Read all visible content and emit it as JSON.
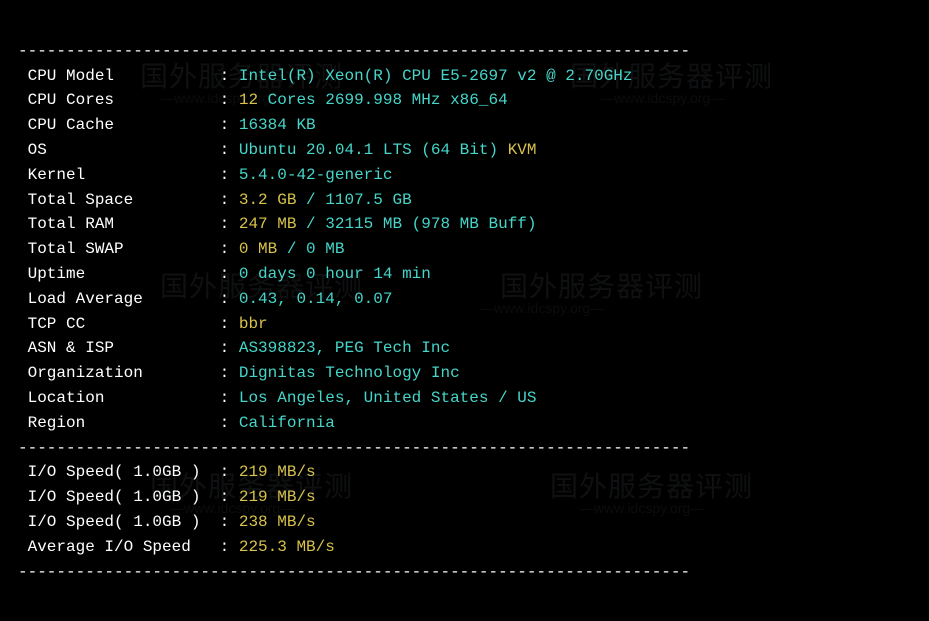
{
  "dash": "----------------------------------------------------------------------",
  "labels": {
    "cpu_model": " CPU Model          ",
    "cpu_cores": " CPU Cores          ",
    "cpu_cache": " CPU Cache          ",
    "os": " OS                 ",
    "kernel": " Kernel             ",
    "space": " Total Space        ",
    "ram": " Total RAM          ",
    "swap": " Total SWAP         ",
    "uptime": " Uptime             ",
    "load": " Load Average       ",
    "tcp": " TCP CC             ",
    "asn": " ASN & ISP          ",
    "org": " Organization       ",
    "loc": " Location           ",
    "region": " Region             ",
    "io1": " I/O Speed( 1.0GB ) ",
    "io2": " I/O Speed( 1.0GB ) ",
    "io3": " I/O Speed( 1.0GB ) ",
    "ioavg": " Average I/O Speed  "
  },
  "sep": " : ",
  "values": {
    "cpu_model": "Intel(R) Xeon(R) CPU E5-2697 v2 @ 2.70GHz",
    "cpu_cores_yellow": "12",
    "cpu_cores_cyan": " Cores 2699.998 MHz x86_64",
    "cpu_cache": "16384 KB",
    "os_cyan": "Ubuntu 20.04.1 LTS (64 Bit) ",
    "os_yellow": "KVM",
    "kernel": "5.4.0-42-generic",
    "space_yellow": "3.2 GB",
    "space_cyan": " / 1107.5 GB",
    "ram_yellow": "247 MB",
    "ram_cyan": " / 32115 MB (978 MB Buff)",
    "swap_yellow": "0 MB",
    "swap_cyan": " / 0 MB",
    "uptime": "0 days 0 hour 14 min",
    "load": "0.43, 0.14, 0.07",
    "tcp": "bbr",
    "asn": "AS398823, PEG Tech Inc",
    "org": "Dignitas Technology Inc",
    "loc": "Los Angeles, United States / US",
    "region": "California",
    "io1": "219 MB/s",
    "io2": "219 MB/s",
    "io3": "238 MB/s",
    "ioavg": "225.3 MB/s"
  },
  "watermark": {
    "main": "国外服务器评测",
    "sub": "—www.idcspy.org—"
  }
}
